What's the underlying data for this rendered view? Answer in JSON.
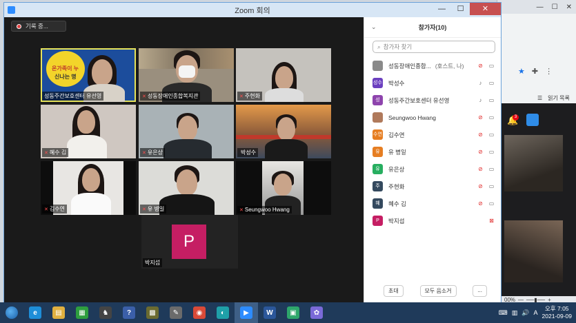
{
  "window": {
    "title": "Zoom 회의",
    "close": "✕",
    "min": "—",
    "max": "☐"
  },
  "recording": {
    "label": "기록 중..."
  },
  "tiles": [
    {
      "name": "성동주간보호센터 유선영",
      "mic": ""
    },
    {
      "name": "성동장애인종합복지관",
      "mic": "✕"
    },
    {
      "name": "주현화",
      "mic": "✕"
    },
    {
      "name": "혜수 김",
      "mic": "✕"
    },
    {
      "name": "유은상",
      "mic": "✕"
    },
    {
      "name": "박성수",
      "mic": ""
    },
    {
      "name": "김수연",
      "mic": "✕"
    },
    {
      "name": "유 병일",
      "mic": "✕"
    },
    {
      "name": "Seungwoo Hwang",
      "mic": "✕"
    }
  ],
  "avatar_tile": {
    "letter": "P",
    "name": "박지섭",
    "color": "#c51e63"
  },
  "poster_text": {
    "line1": "온가족이 누",
    "line2": "신나는 명"
  },
  "panel": {
    "title": "참가자(10)",
    "search_placeholder": "참가자 찾기",
    "invite": "초대",
    "mute_all": "모두 음소거",
    "more": "...",
    "participants": [
      {
        "avatar": "",
        "avatar_color": "#8a8a8a",
        "name": "성동장애인종합...",
        "role": "(호스트, 나)",
        "mic": "muted",
        "cam": "on"
      },
      {
        "avatar": "성수",
        "avatar_color": "#6b3fbf",
        "name": "박성수",
        "role": "",
        "mic": "on",
        "cam": "on"
      },
      {
        "avatar": "성",
        "avatar_color": "#8e44ad",
        "name": "성동주간보호센터 유선영",
        "role": "",
        "mic": "on",
        "cam": "on"
      },
      {
        "avatar": "",
        "avatar_color": "#b07a5c",
        "name": "Seungwoo Hwang",
        "role": "",
        "mic": "muted",
        "cam": "on"
      },
      {
        "avatar": "수연",
        "avatar_color": "#e67e22",
        "name": "김수연",
        "role": "",
        "mic": "muted",
        "cam": "on"
      },
      {
        "avatar": "유",
        "avatar_color": "#e67e22",
        "name": "유 병일",
        "role": "",
        "mic": "muted",
        "cam": "on"
      },
      {
        "avatar": "유",
        "avatar_color": "#27ae60",
        "name": "유은상",
        "role": "",
        "mic": "muted",
        "cam": "on"
      },
      {
        "avatar": "주",
        "avatar_color": "#34495e",
        "name": "주현화",
        "role": "",
        "mic": "muted",
        "cam": "on"
      },
      {
        "avatar": "혜",
        "avatar_color": "#34495e",
        "name": "혜수 김",
        "role": "",
        "mic": "muted",
        "cam": "on"
      },
      {
        "avatar": "P",
        "avatar_color": "#c51e63",
        "name": "박지섭",
        "role": "",
        "mic": "none",
        "cam": "off"
      }
    ]
  },
  "browser": {
    "bookmark": "읽기 목록",
    "badge": "3",
    "zoom_level": "00%",
    "win_min": "—",
    "win_max": "☐",
    "win_close": "✕"
  },
  "taskbar": {
    "time": "오후 7:05",
    "date": "2021-09-09",
    "ime": "A",
    "apps": [
      {
        "icon": "ie-icon",
        "glyph": "e",
        "color": "#1e8ed8"
      },
      {
        "icon": "explorer-icon",
        "glyph": "▤",
        "color": "#e0b040"
      },
      {
        "icon": "store-icon",
        "glyph": "▦",
        "color": "#2e9e3e"
      },
      {
        "icon": "game-icon",
        "glyph": "♞",
        "color": "#444"
      },
      {
        "icon": "help-icon",
        "glyph": "?",
        "color": "#3b5fa8"
      },
      {
        "icon": "tool-icon",
        "glyph": "▩",
        "color": "#6b6b30"
      },
      {
        "icon": "paint-icon",
        "glyph": "✎",
        "color": "#6b6b6b"
      },
      {
        "icon": "chrome-icon",
        "glyph": "◉",
        "color": "#d94a38"
      },
      {
        "icon": "edge-icon",
        "glyph": "◐",
        "color": "#1fa0a8"
      },
      {
        "icon": "zoom-icon",
        "glyph": "▶",
        "color": "#2d8cff"
      },
      {
        "icon": "word-icon",
        "glyph": "W",
        "color": "#2b579a"
      },
      {
        "icon": "game2-icon",
        "glyph": "▣",
        "color": "#2ea66b"
      },
      {
        "icon": "palette-icon",
        "glyph": "✿",
        "color": "#7a6ad8"
      }
    ]
  }
}
